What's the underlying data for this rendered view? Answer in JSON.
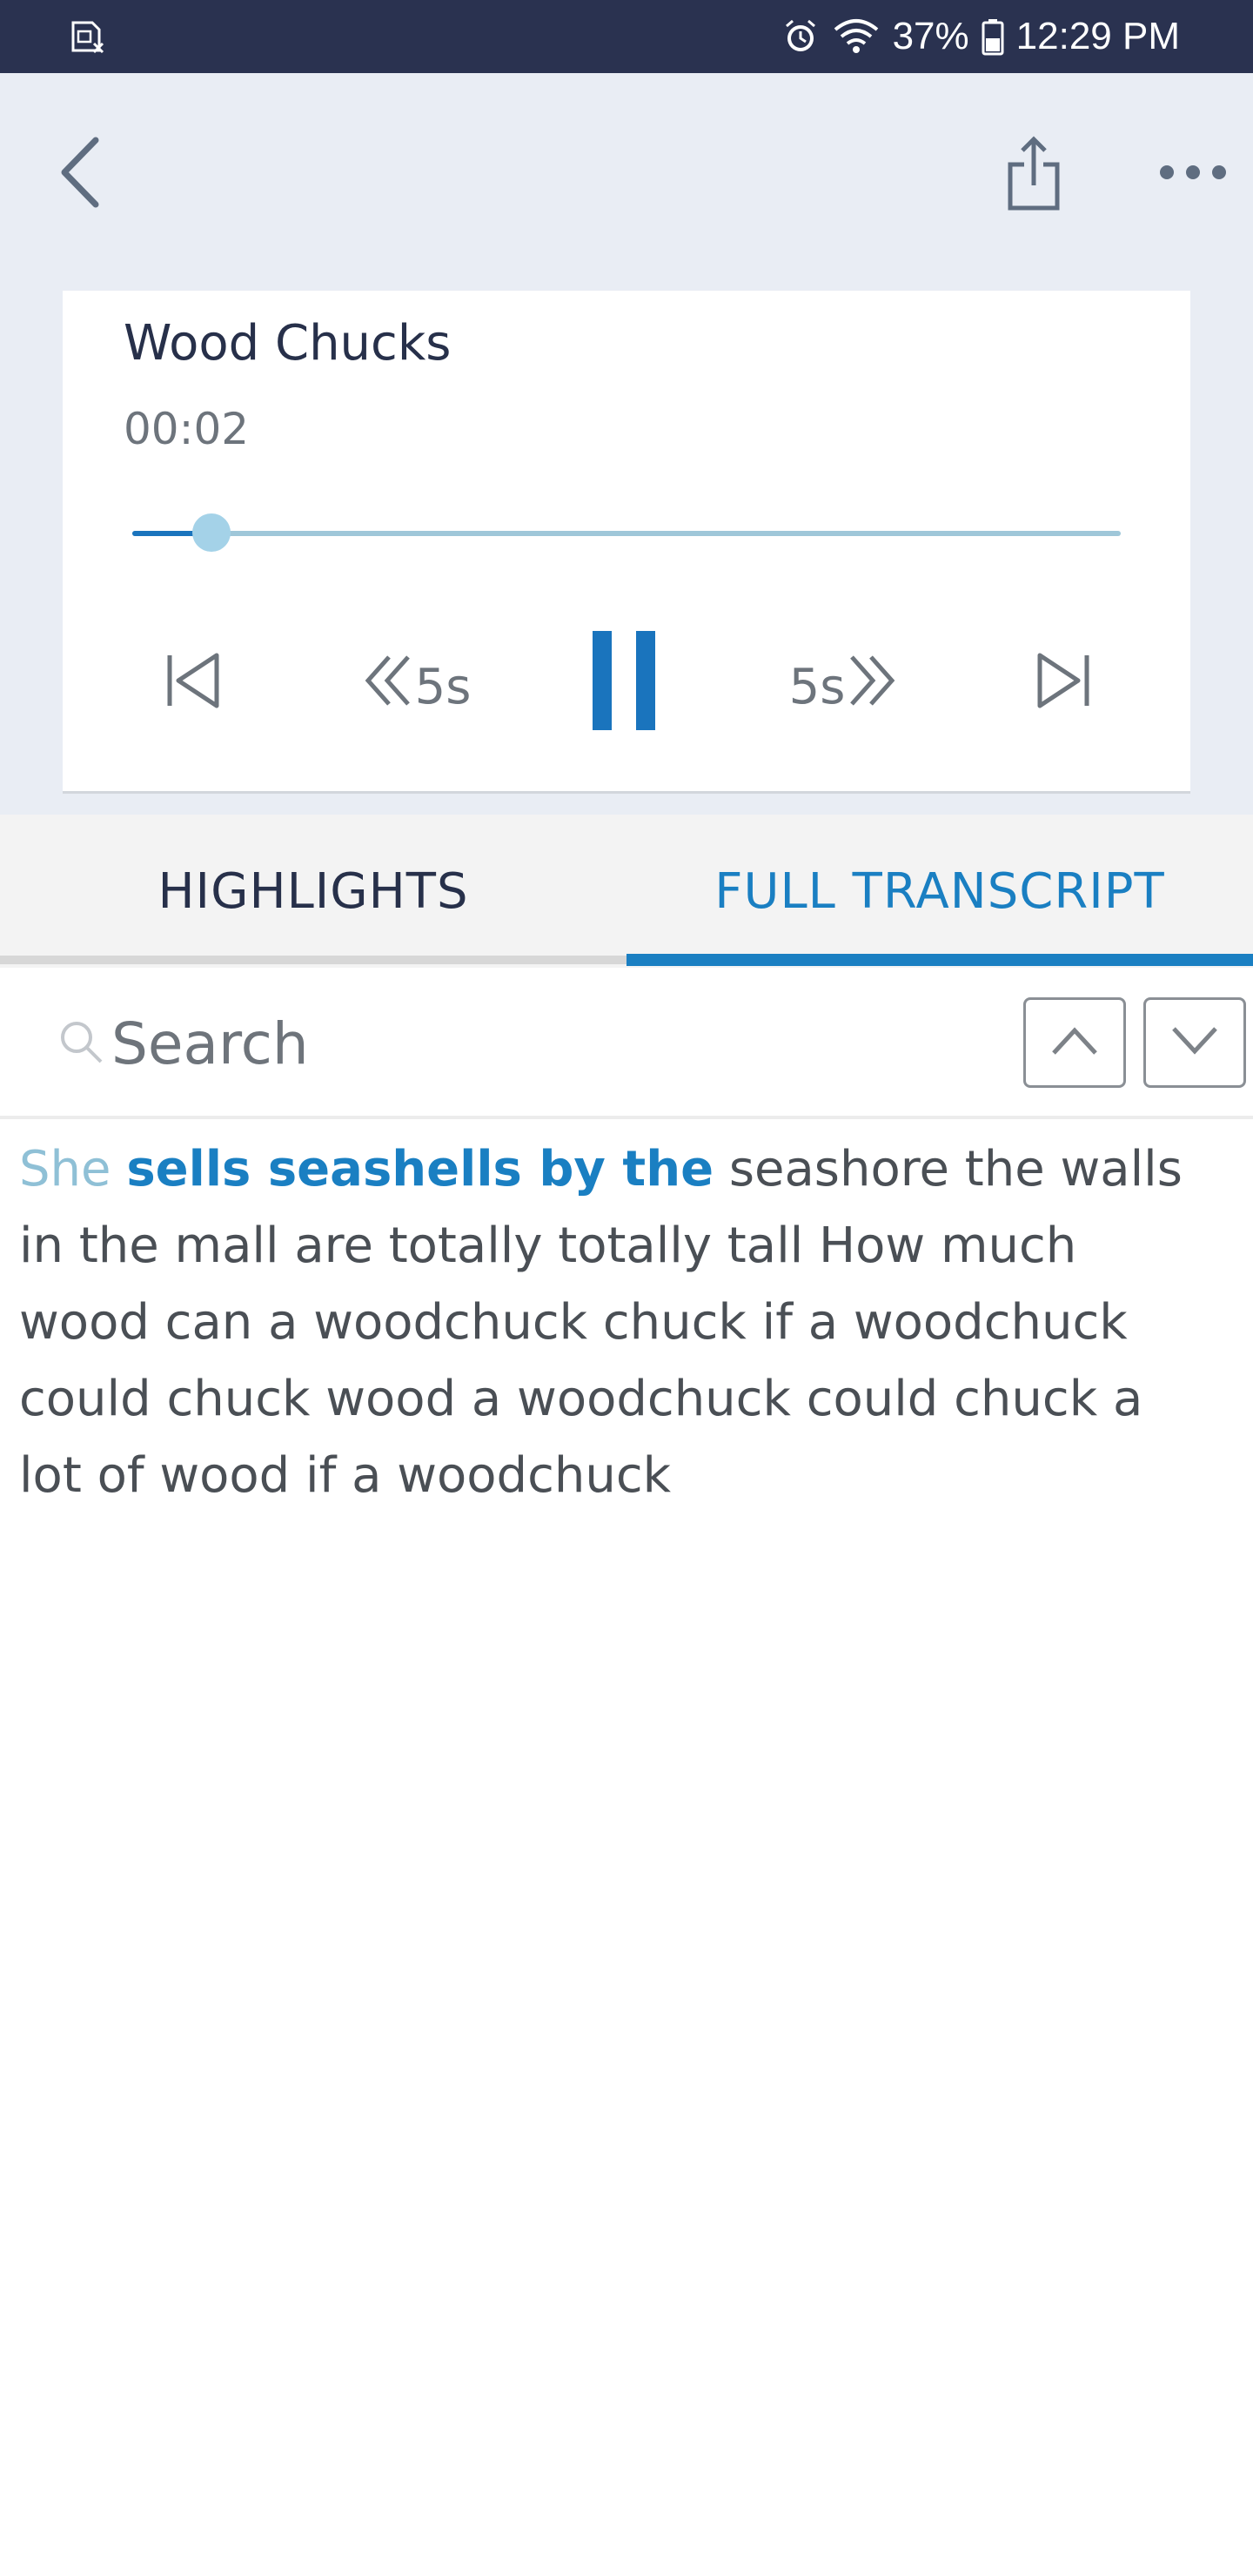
{
  "status_bar": {
    "battery": "37%",
    "time": "12:29 PM",
    "icons": [
      "sim-card-icon",
      "alarm-icon",
      "wifi-icon",
      "battery-icon"
    ]
  },
  "header": {
    "icons": [
      "back-arrow-icon",
      "share-icon",
      "more-dots-icon"
    ]
  },
  "player": {
    "title": "Wood Chucks",
    "elapsed": "00:02",
    "progress_fraction": 0.08,
    "rewind_label": "5s",
    "forward_label": "5s",
    "state": "playing"
  },
  "tabs": {
    "highlights": "HIGHLIGHTS",
    "full_transcript": "FULL TRANSCRIPT",
    "active": "full_transcript"
  },
  "search": {
    "placeholder": "Search"
  },
  "transcript": {
    "played": "She",
    "current": "sells seashells by the",
    "rest": "seashore the walls in the mall are totally totally tall How much wood can a woodchuck chuck if a woodchuck could chuck wood a woodchuck could chuck a lot of wood if a woodchuck"
  },
  "colors": {
    "status_bar": "#2a3250",
    "header_bg": "#e9edf4",
    "accent": "#1a7fc2",
    "played_text": "#8fc0d6",
    "tabs_bg": "#f3f3f3"
  }
}
